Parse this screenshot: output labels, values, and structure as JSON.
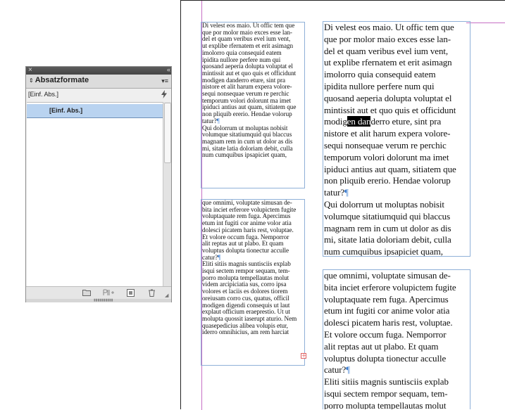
{
  "panel": {
    "title": "Absatzformate",
    "sort_glyph": "⇕",
    "close_glyph": "×",
    "collapse_glyph": "«",
    "menu_glyph": "▾≡",
    "current_style": "[Einf. Abs.]",
    "quick_apply_icon": "lightning-icon",
    "items": [
      {
        "label": "[Einf. Abs.]",
        "selected": true
      }
    ],
    "footer_icons": [
      "folder-icon",
      "style-override-icon",
      "new-style-icon",
      "trash-icon"
    ]
  },
  "document": {
    "small_frame_1": "Di velest eos maio. Ut offic tem que\nque por molor maio exces esse lan-\ndel et quam veribus evel ium vent,\nut explibe rfernatem et erit asimagn\nimolorro quia consequid eatem\nipidita nullore perfere num qui\nquosand aeperia dolupta voluptat el\nmintissit aut et quo quis et officidunt\nmodigen danderro eture, sint pra\nnistore et alit harum expera volore-\nsequi nonsequae verum re perchic\ntemporum volori dolorunt ma imet\nipiduci antius aut quam, sitiatem que\nnon pliquib ererio. Hendae volorup\ntatur?",
    "small_frame_1b": "Qui dolorrum ut moluptas nobisit\nvolumque sitatiumquid qui blaccus\nmagnam rem in cum ut dolor as dis\nmi, sitate latia doloriam debit, culla\nnum cumquibus ipsapiciet quam,",
    "small_frame_2a": "que omnimi, voluptate simusan de-\nbita inciet erferore volupictem fugite\nvoluptaquate rem fuga. Apercimus\netum int fugiti cor anime volor atia\ndolesci picatem haris rest, voluptae.\nEt volore occum fuga. Nemporror\nalit reptas aut ut plabo. Et quam\nvoluptus dolupta tionectur acculle\ncatur?",
    "small_frame_2b": "Eliti sitiis magnis suntisciis explab\nisqui sectem rempor sequam, tem-\nporro molupta tempellautas molut\nvidem arcipiciatia sus, corro ipsa\nvolores et laciis es dolores tiorem\noreiusam corro cus, quatus, officil\nmodigen digendi consequis ut laut\nexplaut officium eraeprestio. Ut ut\nmolupta quossit iaserupt aturio. Nem\nquasepedicius alibea volupis etur,\niderro omnihicius, am rem harciat",
    "large_frame_1_pre": "Di velest eos maio. Ut offic tem que\nque por molor maio exces esse lan-\ndel et quam veribus evel ium vent,\nut explibe rfernatem et erit asimagn\nimolorro quia consequid eatem\nipidita nullore perfere num qui\nquosand aeperia dolupta voluptat el\nmintissit aut et quo quis et officidunt\nmodig",
    "large_frame_1_sel": "en dan",
    "large_frame_1_post": "derro eture, sint pra\nnistore et alit harum expera volore-\nsequi nonsequae verum re perchic\ntemporum volori dolorunt ma imet\nipiduci antius aut quam, sitiatem que\nnon pliquib ererio. Hendae volorup\ntatur?",
    "large_frame_1b": "Qui dolorrum ut moluptas nobisit\nvolumque sitatiumquid qui blaccus\nmagnam rem in cum ut dolor as dis\nmi, sitate latia doloriam debit, culla\nnum cumquibus ipsapiciet quam,",
    "large_frame_2a": "que omnimi, voluptate simusan de-\nbita inciet erferore volupictem fugite\nvoluptaquate rem fuga. Apercimus\netum int fugiti cor anime volor atia\ndolesci picatem haris rest, voluptae.\nEt volore occum fuga. Nemporror\nalit reptas aut ut plabo. Et quam\nvoluptus dolupta tionectur acculle\ncatur?",
    "large_frame_2b": "Eliti sitiis magnis suntisciis explab\nisqui sectem rempor sequam, tem-\nporro molupta tempellautas molut",
    "pilcrow": "¶",
    "overset_glyph": "+"
  }
}
